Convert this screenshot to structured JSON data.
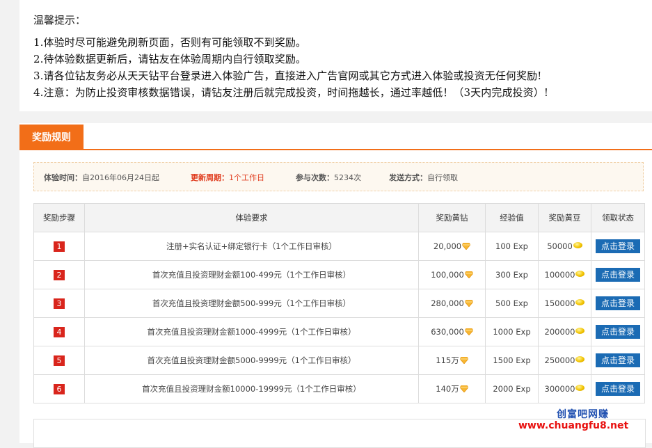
{
  "notice": {
    "title": "温馨提示：",
    "items": [
      "1.体验时尽可能避免刷新页面，否则有可能领取不到奖励。",
      "2.待体验数据更新后，请钻友在体验周期内自行领取奖励。",
      "3.请各位钻友务必从天天钻平台登录进入体验广告，直接进入广告官网或其它方式进入体验或投资无任何奖励!",
      "4.注意：为防止投资审核数据错误，请钻友注册后就完成投资，时间拖越长，通过率越低！（3天内完成投资）!"
    ]
  },
  "tab": {
    "label": "奖励规则"
  },
  "info": {
    "time_label": "体验时间：",
    "time_value": "自2016年06月24日起",
    "cycle_label": "更新周期：",
    "cycle_value": "1个工作日",
    "count_label": "参与次数：",
    "count_value": "5234次",
    "send_label": "发送方式：",
    "send_value": "自行领取"
  },
  "table": {
    "headers": [
      "奖励步骤",
      "体验要求",
      "奖励黄钻",
      "经验值",
      "奖励黄豆",
      "领取状态"
    ],
    "rows": [
      {
        "step": "1",
        "req": "注册+实名认证+绑定银行卡（1个工作日审核）",
        "diamond": "20,000",
        "exp": "100 Exp",
        "beans": "50000",
        "action": "点击登录"
      },
      {
        "step": "2",
        "req": "首次充值且投资理财金额100-499元（1个工作日审核）",
        "diamond": "100,000",
        "exp": "300 Exp",
        "beans": "100000",
        "action": "点击登录"
      },
      {
        "step": "3",
        "req": "首次充值且投资理财金额500-999元（1个工作日审核）",
        "diamond": "280,000",
        "exp": "500 Exp",
        "beans": "150000",
        "action": "点击登录"
      },
      {
        "step": "4",
        "req": "首次充值且投资理财金额1000-4999元（1个工作日审核）",
        "diamond": "630,000",
        "exp": "1000 Exp",
        "beans": "200000",
        "action": "点击登录"
      },
      {
        "step": "5",
        "req": "首次充值且投资理财金额5000-9999元（1个工作日审核）",
        "diamond": "115万",
        "exp": "1500 Exp",
        "beans": "250000",
        "action": "点击登录"
      },
      {
        "step": "6",
        "req": "首次充值且投资理财金额10000-19999元（1个工作日审核）",
        "diamond": "140万",
        "exp": "2000 Exp",
        "beans": "300000",
        "action": "点击登录"
      }
    ]
  },
  "watermark": {
    "line1": "创富吧网赚",
    "line2": "www.chuangfu8.net"
  },
  "colors": {
    "accent": "#f26e18",
    "red": "#d9251c",
    "button": "#1b6bb4"
  }
}
